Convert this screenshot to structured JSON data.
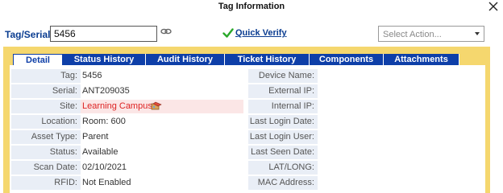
{
  "window": {
    "title": "Tag Information"
  },
  "search": {
    "label": "Tag/Serial:",
    "value": "5456"
  },
  "verify": {
    "label": "Quick Verify"
  },
  "action": {
    "value": "Select Action..."
  },
  "tabs": [
    {
      "label": "Detail"
    },
    {
      "label": "Status History"
    },
    {
      "label": "Audit History"
    },
    {
      "label": "Ticket History"
    },
    {
      "label": "Components"
    },
    {
      "label": "Attachments"
    }
  ],
  "details": {
    "tag": {
      "label": "Tag:",
      "value": "5456"
    },
    "serial": {
      "label": "Serial:",
      "value": "ANT209035"
    },
    "site": {
      "label": "Site:",
      "value": "Learning Campus"
    },
    "location": {
      "label": "Location:",
      "value": "Room: 600"
    },
    "asset_type": {
      "label": "Asset Type:",
      "value": "Parent"
    },
    "status": {
      "label": "Status:",
      "value": "Available"
    },
    "scan_date": {
      "label": "Scan Date:",
      "value": "02/10/2021"
    },
    "rfid": {
      "label": "RFID:",
      "value": "Not Enabled"
    }
  },
  "device": {
    "device_name": {
      "label": "Device Name:",
      "value": ""
    },
    "external_ip": {
      "label": "External IP:",
      "value": ""
    },
    "internal_ip": {
      "label": "Internal IP:",
      "value": ""
    },
    "last_login_date": {
      "label": "Last Login Date:",
      "value": ""
    },
    "last_login_user": {
      "label": "Last Login User:",
      "value": ""
    },
    "last_seen_date": {
      "label": "Last Seen Date:",
      "value": ""
    },
    "lat_long": {
      "label": "LAT/LONG:",
      "value": ""
    },
    "mac_address": {
      "label": "MAC Address:",
      "value": ""
    }
  },
  "colors": {
    "header_blue": "#0e3fa8",
    "panel_yellow": "#f5d76e",
    "label_bg": "#e9eef6",
    "site_red": "#d22222"
  }
}
